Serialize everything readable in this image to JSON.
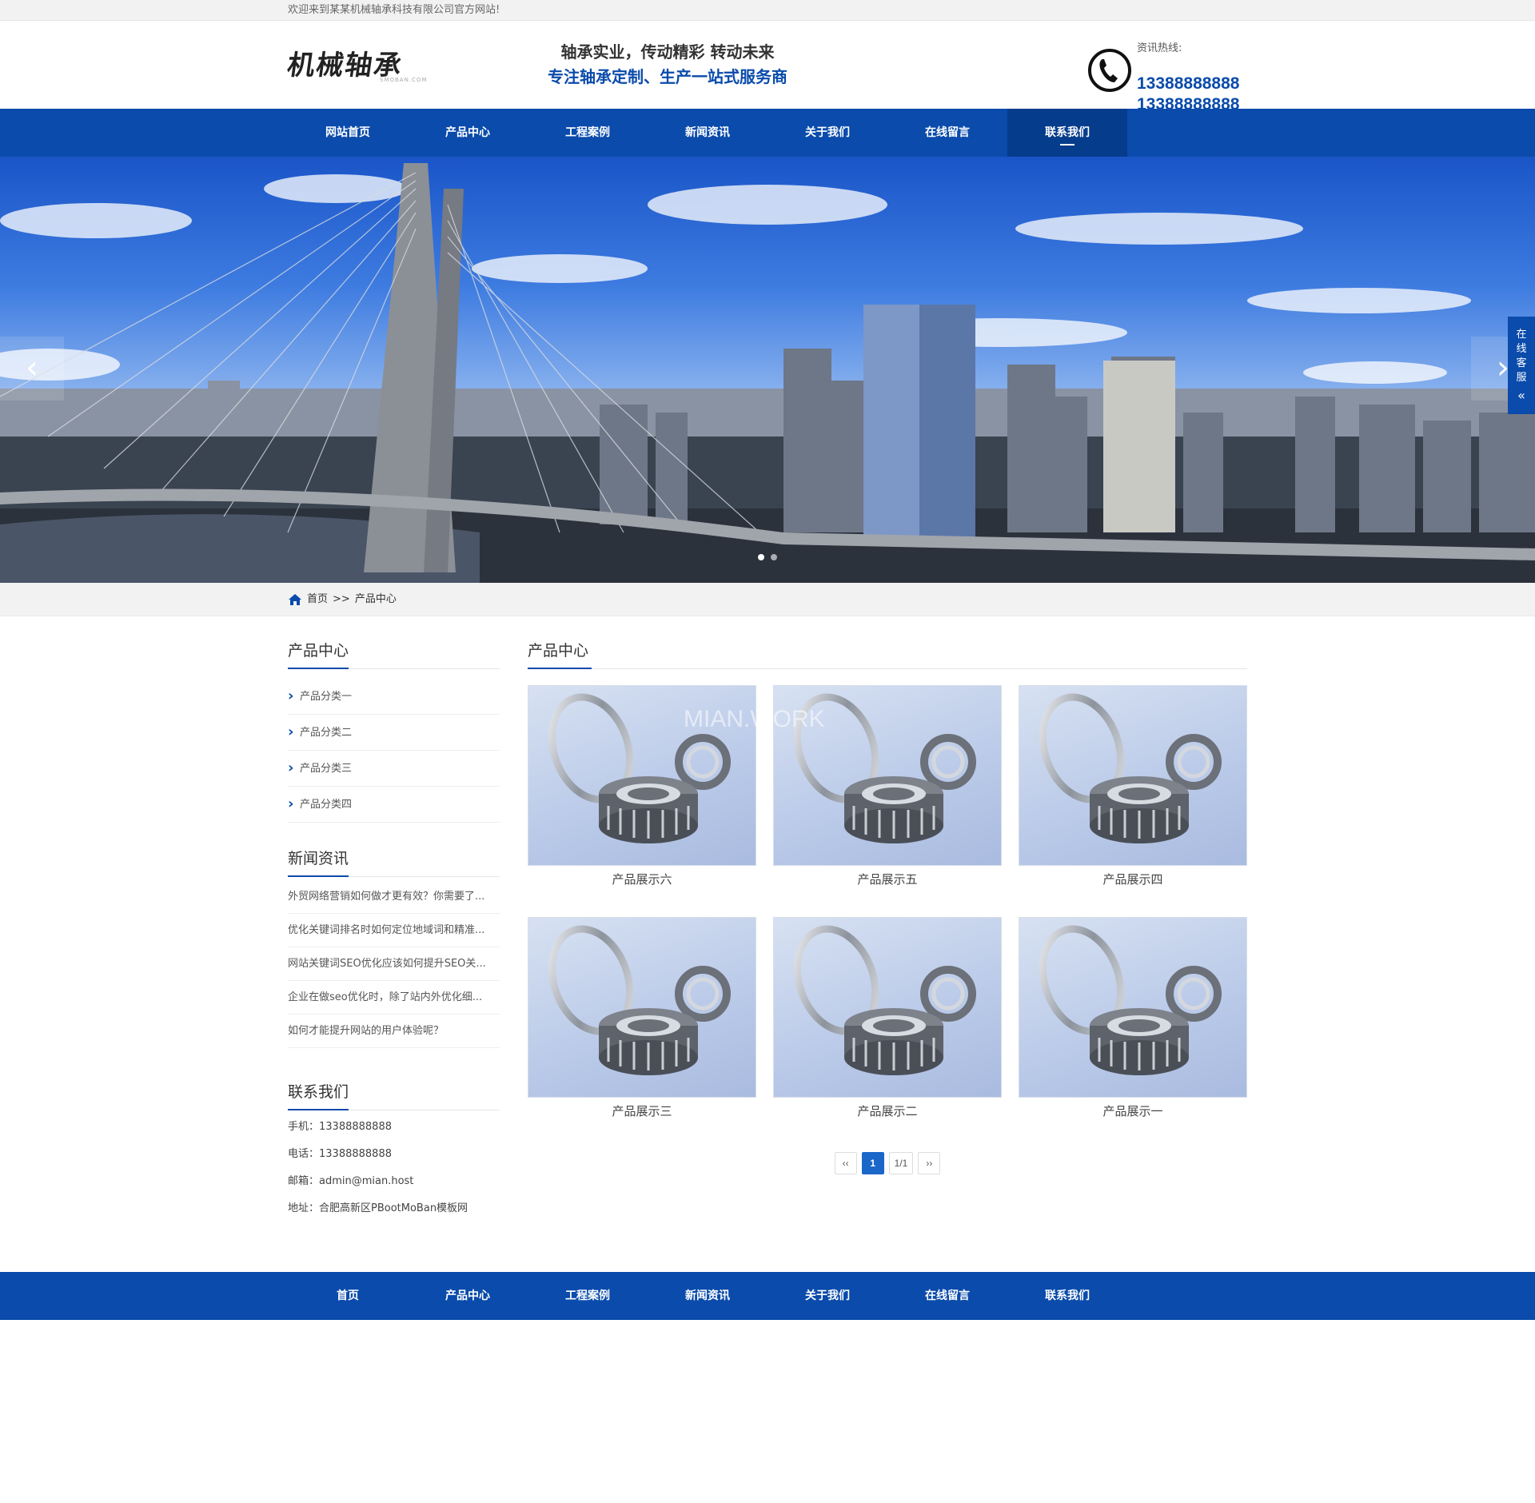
{
  "topbar": {
    "welcome": "欢迎来到某某机械轴承科技有限公司官方网站!"
  },
  "header": {
    "logo_text": "机械轴承",
    "logo_sub": "SMOBAN.COM",
    "slogan_line1": "轴承实业，传动精彩 转动未来",
    "slogan_line2": "专注轴承定制、生产一站式服务商",
    "hotline_label": "资讯热线:",
    "hotline_1": "13388888888",
    "hotline_2": "13388888888"
  },
  "nav": {
    "items": [
      {
        "label": "网站首页"
      },
      {
        "label": "产品中心"
      },
      {
        "label": "工程案例"
      },
      {
        "label": "新闻资讯"
      },
      {
        "label": "关于我们"
      },
      {
        "label": "在线留言"
      },
      {
        "label": "联系我们"
      }
    ],
    "active": "联系我们"
  },
  "banner": {
    "prev_icon": "chevron-left-icon",
    "next_icon": "chevron-right-icon",
    "slides": 2,
    "current": 1
  },
  "service": {
    "label": [
      "在",
      "线",
      "客",
      "服"
    ],
    "icon": "double-chevron-left-icon"
  },
  "breadcrumb": {
    "home": "首页",
    "separator": ">>",
    "current": "产品中心"
  },
  "sidebar": {
    "categories_title": "产品中心",
    "categories": [
      "产品分类一",
      "产品分类二",
      "产品分类三",
      "产品分类四"
    ],
    "news_title": "新闻资讯",
    "news": [
      "外贸网络营销如何做才更有效？你需要了...",
      "优化关键词排名时如何定位地域词和精准...",
      "网站关键词SEO优化应该如何提升SEO关...",
      "企业在做seo优化时，除了站内外优化细...",
      "如何才能提升网站的用户体验呢？"
    ],
    "contact_title": "联系我们",
    "contact": [
      "手机：13388888888",
      "电话：13388888888",
      "邮箱：admin@mian.host",
      "地址：合肥高新区PBootMoBan模板网"
    ]
  },
  "content": {
    "title": "产品中心",
    "watermark": "MIAN.WORK",
    "products": [
      {
        "name": "产品展示六"
      },
      {
        "name": "产品展示五"
      },
      {
        "name": "产品展示四"
      },
      {
        "name": "产品展示三"
      },
      {
        "name": "产品展示二"
      },
      {
        "name": "产品展示一"
      }
    ],
    "pager": {
      "prev": "‹‹",
      "current": "1",
      "total": "1/1",
      "next": "››"
    }
  },
  "footer": {
    "items": [
      {
        "label": "首页"
      },
      {
        "label": "产品中心"
      },
      {
        "label": "工程案例"
      },
      {
        "label": "新闻资讯"
      },
      {
        "label": "关于我们"
      },
      {
        "label": "在线留言"
      },
      {
        "label": "联系我们"
      }
    ]
  },
  "colors": {
    "brand_blue": "#0a4bab",
    "nav_active": "#063c8c",
    "pager_active": "#1b66c9"
  }
}
